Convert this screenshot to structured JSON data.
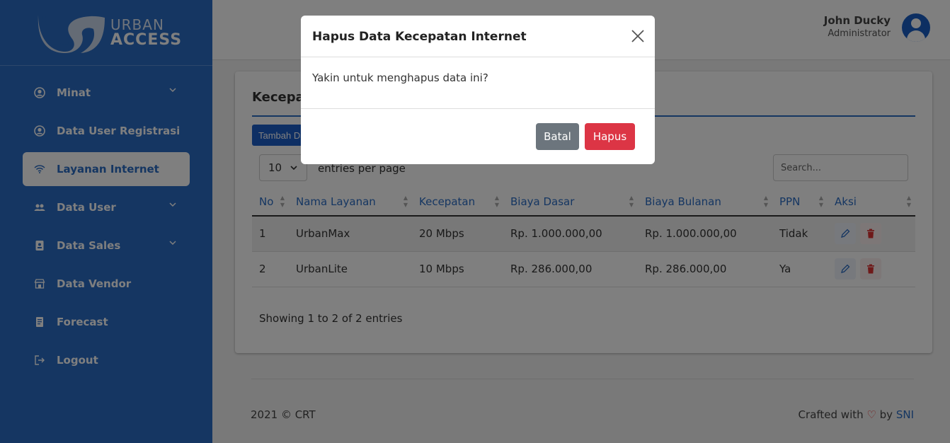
{
  "brand": {
    "line1": "URBAN",
    "line2": "ACCESS"
  },
  "sidebar": {
    "items": [
      {
        "label": "Minat",
        "icon": "user-circle-icon",
        "has_chevron": true
      },
      {
        "label": "Data User Registrasi",
        "icon": "user-circle-icon",
        "has_chevron": false
      },
      {
        "label": "Layanan Internet",
        "icon": "wifi-icon",
        "has_chevron": false,
        "active": true
      },
      {
        "label": "Data User",
        "icon": "users-icon",
        "has_chevron": true
      },
      {
        "label": "Data Sales",
        "icon": "badge-icon",
        "has_chevron": true
      },
      {
        "label": "Data Vendor",
        "icon": "store-icon",
        "has_chevron": false
      },
      {
        "label": "Forecast",
        "icon": "document-icon",
        "has_chevron": false
      },
      {
        "label": "Logout",
        "icon": "logout-icon",
        "has_chevron": false
      }
    ]
  },
  "header": {
    "user_name": "John Ducky",
    "user_role": "Administrator"
  },
  "card": {
    "title": "Kecepatan Internet",
    "add_button": "Tambah Data",
    "entries_value": "10",
    "entries_label": "entries per page",
    "search_placeholder": "Search...",
    "columns": [
      "No",
      "Nama Layanan",
      "Kecepatan",
      "Biaya Dasar",
      "Biaya Bulanan",
      "PPN",
      "Aksi"
    ],
    "rows": [
      [
        "1",
        "UrbanMax",
        "20 Mbps",
        "Rp. 1.000.000,00",
        "Rp. 1.000.000,00",
        "Tidak"
      ],
      [
        "2",
        "UrbanLite",
        "10 Mbps",
        "Rp. 286.000,00",
        "Rp. 286.000,00",
        "Ya"
      ]
    ],
    "showing": "Showing 1 to 2 of 2 entries"
  },
  "footer": {
    "left": "2021 © CRT",
    "crafted": "Crafted with",
    "by": "by",
    "author": "SNI"
  },
  "modal": {
    "title": "Hapus Data Kecepatan Internet",
    "body": "Yakin untuk menghapus data ini?",
    "cancel_label": "Batal",
    "confirm_label": "Hapus"
  },
  "colors": {
    "primary": "#2a6cc4",
    "danger": "#dc3545",
    "secondary": "#6c757d"
  }
}
